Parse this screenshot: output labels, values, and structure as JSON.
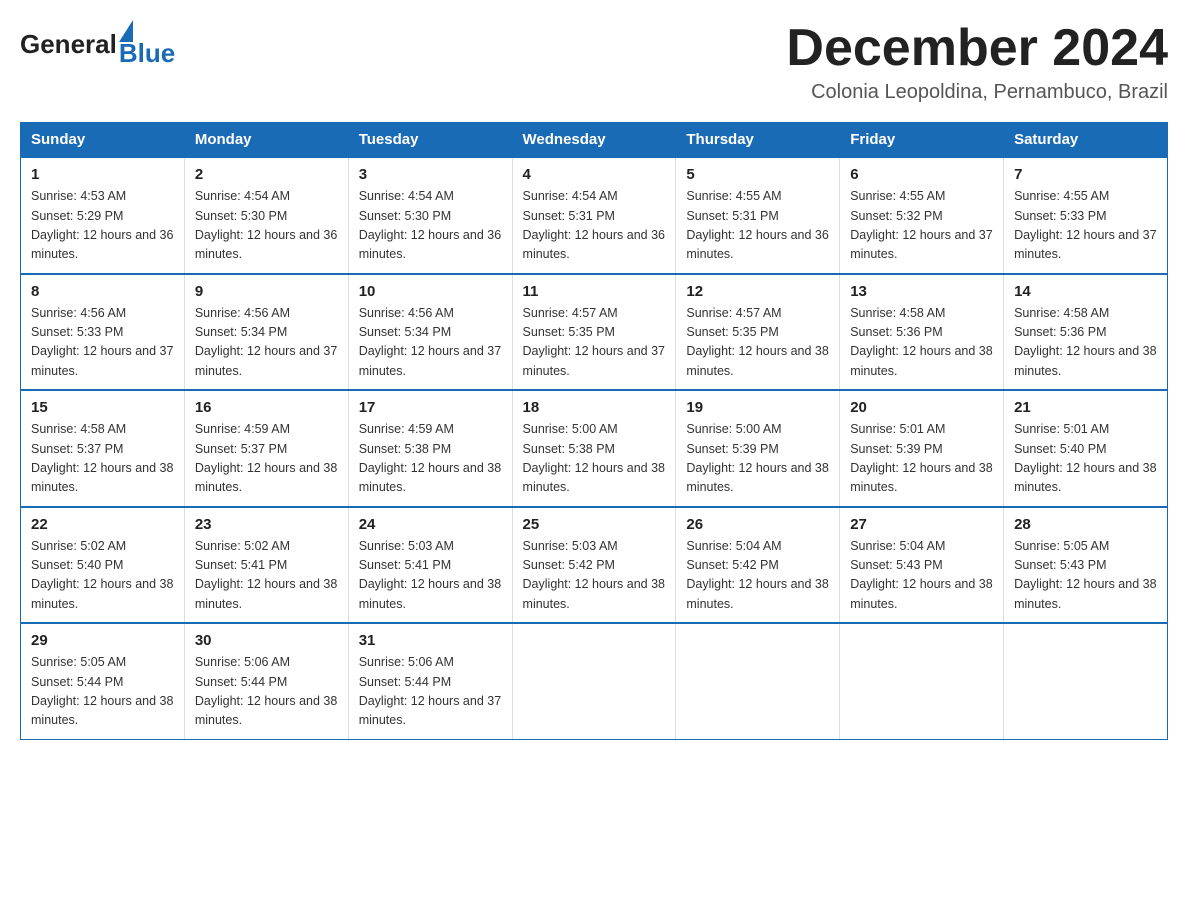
{
  "header": {
    "logo_general": "General",
    "logo_blue": "Blue",
    "month_title": "December 2024",
    "location": "Colonia Leopoldina, Pernambuco, Brazil"
  },
  "days_of_week": [
    "Sunday",
    "Monday",
    "Tuesday",
    "Wednesday",
    "Thursday",
    "Friday",
    "Saturday"
  ],
  "weeks": [
    [
      {
        "day": "1",
        "sunrise": "4:53 AM",
        "sunset": "5:29 PM",
        "daylight": "12 hours and 36 minutes."
      },
      {
        "day": "2",
        "sunrise": "4:54 AM",
        "sunset": "5:30 PM",
        "daylight": "12 hours and 36 minutes."
      },
      {
        "day": "3",
        "sunrise": "4:54 AM",
        "sunset": "5:30 PM",
        "daylight": "12 hours and 36 minutes."
      },
      {
        "day": "4",
        "sunrise": "4:54 AM",
        "sunset": "5:31 PM",
        "daylight": "12 hours and 36 minutes."
      },
      {
        "day": "5",
        "sunrise": "4:55 AM",
        "sunset": "5:31 PM",
        "daylight": "12 hours and 36 minutes."
      },
      {
        "day": "6",
        "sunrise": "4:55 AM",
        "sunset": "5:32 PM",
        "daylight": "12 hours and 37 minutes."
      },
      {
        "day": "7",
        "sunrise": "4:55 AM",
        "sunset": "5:33 PM",
        "daylight": "12 hours and 37 minutes."
      }
    ],
    [
      {
        "day": "8",
        "sunrise": "4:56 AM",
        "sunset": "5:33 PM",
        "daylight": "12 hours and 37 minutes."
      },
      {
        "day": "9",
        "sunrise": "4:56 AM",
        "sunset": "5:34 PM",
        "daylight": "12 hours and 37 minutes."
      },
      {
        "day": "10",
        "sunrise": "4:56 AM",
        "sunset": "5:34 PM",
        "daylight": "12 hours and 37 minutes."
      },
      {
        "day": "11",
        "sunrise": "4:57 AM",
        "sunset": "5:35 PM",
        "daylight": "12 hours and 37 minutes."
      },
      {
        "day": "12",
        "sunrise": "4:57 AM",
        "sunset": "5:35 PM",
        "daylight": "12 hours and 38 minutes."
      },
      {
        "day": "13",
        "sunrise": "4:58 AM",
        "sunset": "5:36 PM",
        "daylight": "12 hours and 38 minutes."
      },
      {
        "day": "14",
        "sunrise": "4:58 AM",
        "sunset": "5:36 PM",
        "daylight": "12 hours and 38 minutes."
      }
    ],
    [
      {
        "day": "15",
        "sunrise": "4:58 AM",
        "sunset": "5:37 PM",
        "daylight": "12 hours and 38 minutes."
      },
      {
        "day": "16",
        "sunrise": "4:59 AM",
        "sunset": "5:37 PM",
        "daylight": "12 hours and 38 minutes."
      },
      {
        "day": "17",
        "sunrise": "4:59 AM",
        "sunset": "5:38 PM",
        "daylight": "12 hours and 38 minutes."
      },
      {
        "day": "18",
        "sunrise": "5:00 AM",
        "sunset": "5:38 PM",
        "daylight": "12 hours and 38 minutes."
      },
      {
        "day": "19",
        "sunrise": "5:00 AM",
        "sunset": "5:39 PM",
        "daylight": "12 hours and 38 minutes."
      },
      {
        "day": "20",
        "sunrise": "5:01 AM",
        "sunset": "5:39 PM",
        "daylight": "12 hours and 38 minutes."
      },
      {
        "day": "21",
        "sunrise": "5:01 AM",
        "sunset": "5:40 PM",
        "daylight": "12 hours and 38 minutes."
      }
    ],
    [
      {
        "day": "22",
        "sunrise": "5:02 AM",
        "sunset": "5:40 PM",
        "daylight": "12 hours and 38 minutes."
      },
      {
        "day": "23",
        "sunrise": "5:02 AM",
        "sunset": "5:41 PM",
        "daylight": "12 hours and 38 minutes."
      },
      {
        "day": "24",
        "sunrise": "5:03 AM",
        "sunset": "5:41 PM",
        "daylight": "12 hours and 38 minutes."
      },
      {
        "day": "25",
        "sunrise": "5:03 AM",
        "sunset": "5:42 PM",
        "daylight": "12 hours and 38 minutes."
      },
      {
        "day": "26",
        "sunrise": "5:04 AM",
        "sunset": "5:42 PM",
        "daylight": "12 hours and 38 minutes."
      },
      {
        "day": "27",
        "sunrise": "5:04 AM",
        "sunset": "5:43 PM",
        "daylight": "12 hours and 38 minutes."
      },
      {
        "day": "28",
        "sunrise": "5:05 AM",
        "sunset": "5:43 PM",
        "daylight": "12 hours and 38 minutes."
      }
    ],
    [
      {
        "day": "29",
        "sunrise": "5:05 AM",
        "sunset": "5:44 PM",
        "daylight": "12 hours and 38 minutes."
      },
      {
        "day": "30",
        "sunrise": "5:06 AM",
        "sunset": "5:44 PM",
        "daylight": "12 hours and 38 minutes."
      },
      {
        "day": "31",
        "sunrise": "5:06 AM",
        "sunset": "5:44 PM",
        "daylight": "12 hours and 37 minutes."
      },
      null,
      null,
      null,
      null
    ]
  ],
  "labels": {
    "sunrise_prefix": "Sunrise: ",
    "sunset_prefix": "Sunset: ",
    "daylight_prefix": "Daylight: "
  }
}
